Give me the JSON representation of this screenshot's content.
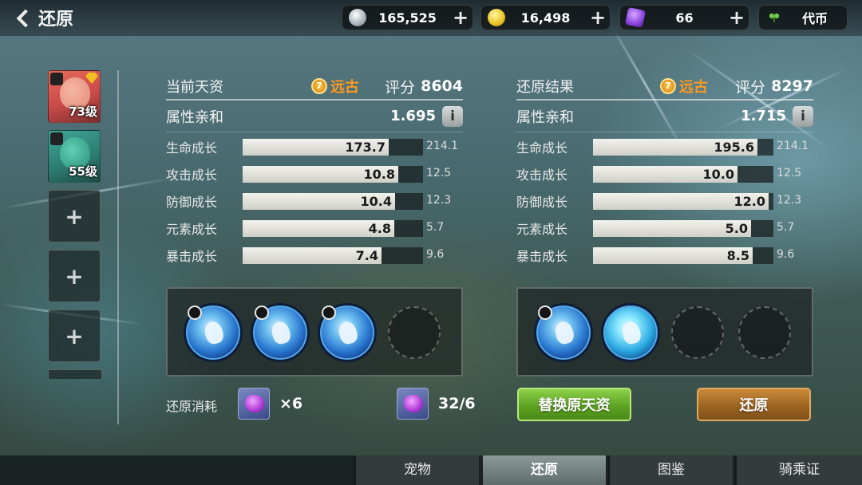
{
  "header": {
    "back_title": "还原",
    "currencies": [
      {
        "icon": "silver-coin-icon",
        "value": "165,525"
      },
      {
        "icon": "gold-coin-icon",
        "value": "16,498"
      },
      {
        "icon": "purple-gem-icon",
        "value": "66"
      },
      {
        "icon": "leaf-token-icon",
        "value": "代币"
      }
    ]
  },
  "pets": [
    {
      "level": "73级"
    },
    {
      "level": "55级"
    }
  ],
  "empty_slot_symbol": "+",
  "current": {
    "title": "当前天资",
    "rank": "远古",
    "score_label": "评分",
    "score": "8604",
    "affinity_label": "属性亲和",
    "affinity_value": "1.695",
    "info_symbol": "i",
    "stats": [
      {
        "label": "生命成长",
        "value": "173.7",
        "max": "214.1"
      },
      {
        "label": "攻击成长",
        "value": "10.8",
        "max": "12.5"
      },
      {
        "label": "防御成长",
        "value": "10.4",
        "max": "12.3"
      },
      {
        "label": "元素成长",
        "value": "4.8",
        "max": "5.7"
      },
      {
        "label": "暴击成长",
        "value": "7.4",
        "max": "9.6"
      }
    ]
  },
  "result": {
    "title": "还原结果",
    "rank": "远古",
    "score_label": "评分",
    "score": "8297",
    "affinity_label": "属性亲和",
    "affinity_value": "1.715",
    "info_symbol": "i",
    "stats": [
      {
        "label": "生命成长",
        "value": "195.6",
        "max": "214.1"
      },
      {
        "label": "攻击成长",
        "value": "10.0",
        "max": "12.5"
      },
      {
        "label": "防御成长",
        "value": "12.0",
        "max": "12.3"
      },
      {
        "label": "元素成长",
        "value": "5.0",
        "max": "5.7"
      },
      {
        "label": "暴击成长",
        "value": "8.5",
        "max": "9.6"
      }
    ]
  },
  "cost": {
    "label": "还原消耗",
    "amount": "×6",
    "owned": "32/6"
  },
  "buttons": {
    "replace": "替换原天资",
    "restore": "还原"
  },
  "tabs": [
    "宠物",
    "还原",
    "图鉴",
    "骑乘证"
  ],
  "active_tab": "还原"
}
